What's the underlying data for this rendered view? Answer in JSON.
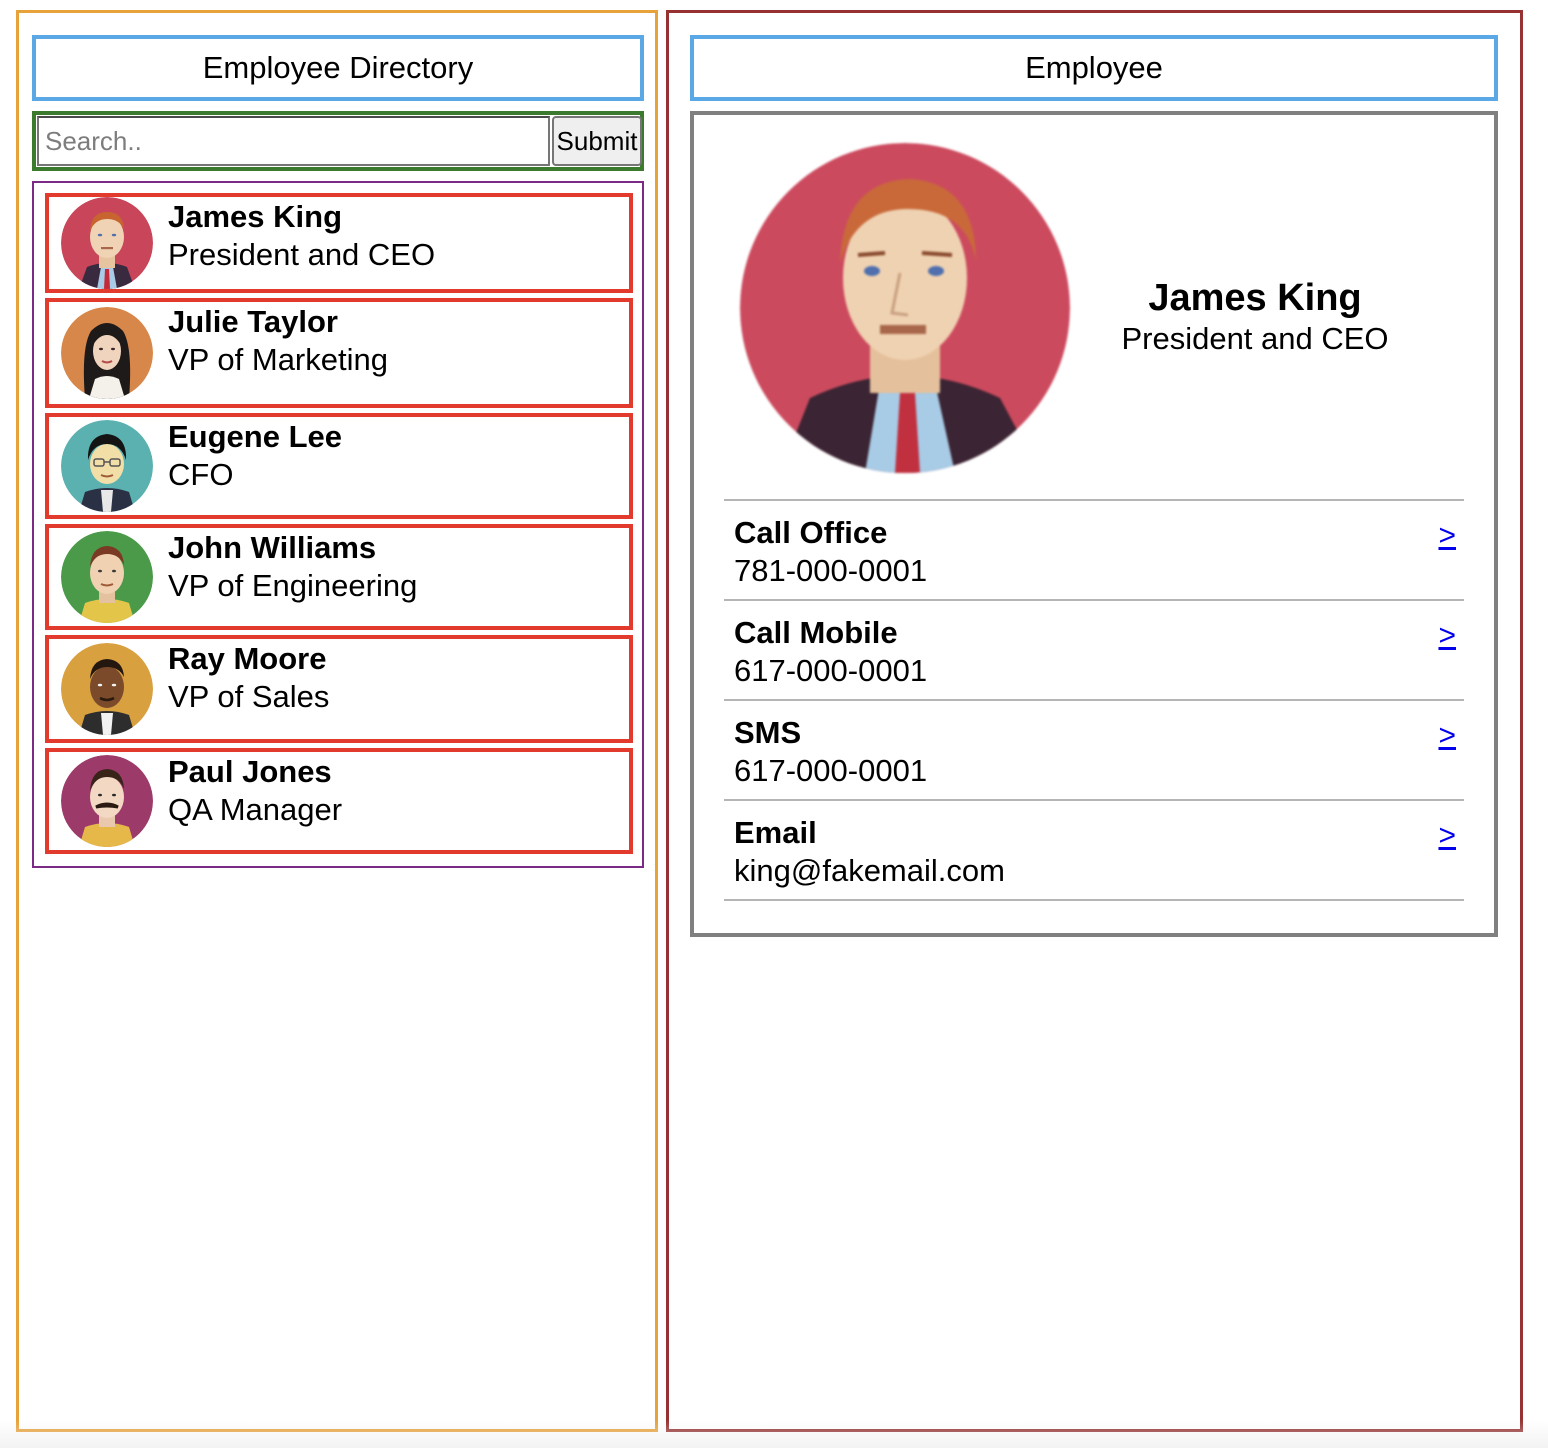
{
  "directory": {
    "header": "Employee Directory",
    "search": {
      "placeholder": "Search..",
      "value": ""
    },
    "submit_label": "Submit",
    "employees": [
      {
        "name": "James King",
        "title": "President and CEO",
        "avatar_color": "#c9465a"
      },
      {
        "name": "Julie Taylor",
        "title": "VP of Marketing",
        "avatar_color": "#d8874a"
      },
      {
        "name": "Eugene Lee",
        "title": "CFO",
        "avatar_color": "#5bb0b0"
      },
      {
        "name": "John Williams",
        "title": "VP of Engineering",
        "avatar_color": "#4a9a4a"
      },
      {
        "name": "Ray Moore",
        "title": "VP of Sales",
        "avatar_color": "#d9a040"
      },
      {
        "name": "Paul Jones",
        "title": "QA Manager",
        "avatar_color": "#9c3a6a"
      }
    ]
  },
  "employee": {
    "header": "Employee",
    "name": "James King",
    "title": "President and CEO",
    "actions": [
      {
        "label": "Call Office",
        "value": "781-000-0001",
        "link": ">"
      },
      {
        "label": "Call Mobile",
        "value": "617-000-0001",
        "link": ">"
      },
      {
        "label": "SMS",
        "value": "617-000-0001",
        "link": ">"
      },
      {
        "label": "Email",
        "value": "king@fakemail.com",
        "link": ">"
      }
    ]
  },
  "colors": {
    "directory_border": "#e8a23a",
    "employee_border": "#963232",
    "header_border": "#5aa9e6",
    "search_border": "#3c7a2e",
    "list_border": "#7b2a86",
    "item_border": "#e23b2e",
    "card_border": "#808080",
    "link": "#0000ee"
  }
}
